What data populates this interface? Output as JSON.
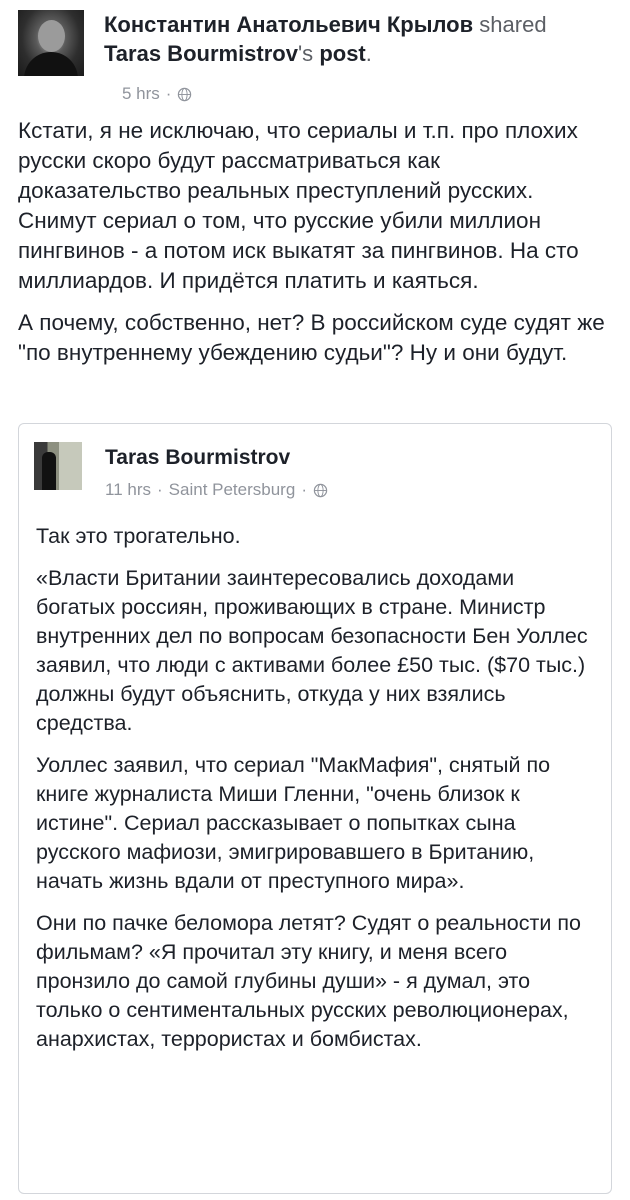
{
  "header": {
    "sharer": "Константин Анатольевич Крылов",
    "shared_word": "shared",
    "original_author": "Taras Bourmistrov",
    "possessive": "'s",
    "post_word": "post",
    "period": ".",
    "time": "5 hrs",
    "separator": "·",
    "icon": "globe-icon"
  },
  "post": {
    "paragraphs": [
      "Кстати, я не исключаю, что сериалы и т.п. про плохих русски скоро будут рассматриваться как доказательство реальных преступлений русских. Снимут сериал о том, что русские убили миллион пингвинов - а потом иск выкатят за пингвинов. На сто миллиардов. И придётся платить и каяться.",
      "А почему, собственно, нет? В российском суде судят же \"по внутреннему убеждению судьи\"? Ну и они будут."
    ]
  },
  "shared_card": {
    "author": "Taras Bourmistrov",
    "time": "11 hrs",
    "separator": "·",
    "location": "Saint Petersburg",
    "icon": "globe-icon",
    "paragraphs": [
      "Так это трогательно.",
      "«Власти Британии заинтересовались доходами богатых россиян, проживающих в стране. Министр внутренних дел по вопросам безопасности Бен Уоллес заявил, что люди с активами более £50 тыс. ($70 тыс.) должны будут объяснить, откуда у них взялись средства.",
      "Уоллес заявил, что сериал \"МакМафия\", снятый по книге журналиста Миши Гленни, \"очень близок к истине\". Сериал рассказывает о попытках сына русского мафиози, эмигрировавшего в Британию, начать жизнь вдали от преступного мира».",
      "Они по пачке беломора летят? Судят о реальности по фильмам? «Я прочитал эту книгу, и меня всего пронзило до самой глубины души» - я думал, это только о сентиментальных русских революционерах, анархистах, террористах и бомбистах."
    ]
  }
}
